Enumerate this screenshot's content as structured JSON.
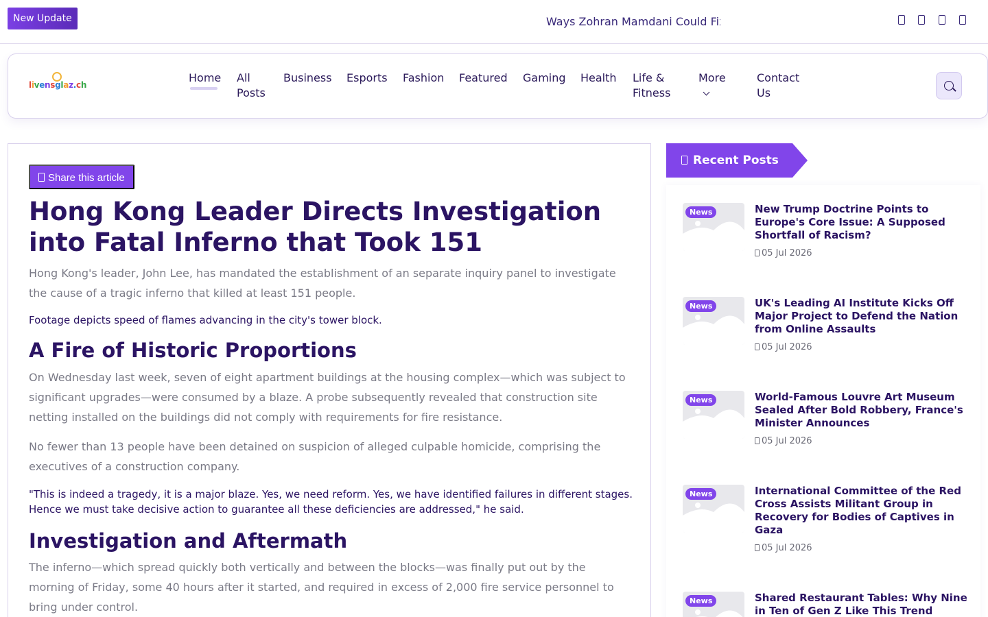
{
  "topbar": {
    "update_label": "New Update",
    "ticker_text": "Ways Zohran Mamdani Could Fix New York",
    "social_icons": [
      "facebook-icon",
      "twitter-icon",
      "instagram-icon",
      "youtube-icon"
    ]
  },
  "header": {
    "logo_text": "livensglaz.ch",
    "nav": [
      {
        "label": "Home",
        "active": true
      },
      {
        "label": "All Posts"
      },
      {
        "label": "Business"
      },
      {
        "label": "Esports"
      },
      {
        "label": "Fashion"
      },
      {
        "label": "Featured"
      },
      {
        "label": "Gaming"
      },
      {
        "label": "Health"
      },
      {
        "label": "Life & Fitness"
      },
      {
        "label": "More"
      },
      {
        "label": "Contact Us"
      }
    ],
    "search_icon": "search-icon"
  },
  "article": {
    "share_label": "Share this article",
    "title": "Hong Kong Leader Directs Investigation into Fatal Inferno that Took 151",
    "lead": "Hong Kong's leader, John Lee, has mandated the establishment of an separate inquiry panel to investigate the cause of a tragic inferno that killed at least 151 people.",
    "caption": "Footage depicts speed of flames advancing in the city's tower block.",
    "h2_1": "A Fire of Historic Proportions",
    "p1": "On Wednesday last week, seven of eight apartment buildings at the housing complex—which was subject to significant upgrades—were consumed by a blaze. A probe subsequently revealed that construction site netting installed on the buildings did not comply with requirements for fire resistance.",
    "p2": "No fewer than 13 people have been detained on suspicion of alleged culpable homicide, comprising the executives of a construction company.",
    "quote": "\"This is indeed a tragedy, it is a major blaze. Yes, we need reform. Yes, we have identified failures in different stages. Hence we must take decisive action to guarantee all these deficiencies are addressed,\" he said.",
    "h2_2": "Investigation and Aftermath",
    "p3": "The inferno—which spread quickly both vertically and between the blocks—was finally put out by the morning of Friday, some 40 hours after it started, and required in excess of 2,000 fire service personnel to bring under control."
  },
  "sidebar": {
    "heading": "Recent Posts",
    "posts": [
      {
        "tag": "News",
        "title": "New Trump Doctrine Points to Europe's Core Issue: A Supposed Shortfall of Racism?",
        "date": "05 Jul 2026"
      },
      {
        "tag": "News",
        "title": "UK's Leading AI Institute Kicks Off Major Project to Defend the Nation from Online Assaults",
        "date": "05 Jul 2026"
      },
      {
        "tag": "News",
        "title": "World-Famous Louvre Art Museum Sealed After Bold Robbery, France's Minister Announces",
        "date": "05 Jul 2026"
      },
      {
        "tag": "News",
        "title": "International Committee of the Red Cross Assists Militant Group in Recovery for Bodies of Captives in Gaza",
        "date": "05 Jul 2026"
      },
      {
        "tag": "News",
        "title": "Shared Restaurant Tables: Why Nine in Ten of Gen Z Like This Trend",
        "date": ""
      }
    ]
  }
}
